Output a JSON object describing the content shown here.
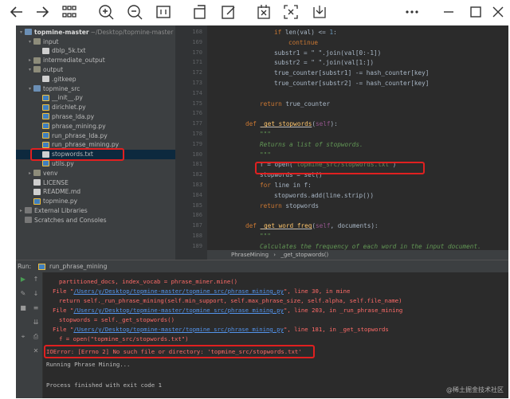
{
  "toolbar": {
    "icons": [
      "back-icon",
      "forward-icon",
      "grid-icon",
      "zoom-in-icon",
      "zoom-out-icon",
      "fit-icon",
      "rotate-icon",
      "edit-icon",
      "grid-select-icon",
      "crop-icon",
      "download-icon",
      "more-icon",
      "minimize-icon",
      "maximize-icon",
      "close-icon"
    ]
  },
  "tree": {
    "root_name": "topmine-master",
    "root_path": "~/Desktop/topmine-master",
    "items": [
      {
        "label": "input",
        "kind": "folder",
        "depth": 1,
        "arrow": "▾"
      },
      {
        "label": "dblp_5k.txt",
        "kind": "txt",
        "depth": 2
      },
      {
        "label": "intermediate_output",
        "kind": "folder",
        "depth": 1,
        "arrow": "▸"
      },
      {
        "label": "output",
        "kind": "folder",
        "depth": 1,
        "arrow": "▾"
      },
      {
        "label": ".gitkeep",
        "kind": "txt",
        "depth": 2
      },
      {
        "label": "topmine_src",
        "kind": "folderb",
        "depth": 1,
        "arrow": "▾"
      },
      {
        "label": "__init__.py",
        "kind": "py",
        "depth": 2
      },
      {
        "label": "dirichlet.py",
        "kind": "py",
        "depth": 2
      },
      {
        "label": "phrase_lda.py",
        "kind": "py",
        "depth": 2
      },
      {
        "label": "phrase_mining.py",
        "kind": "py",
        "depth": 2
      },
      {
        "label": "run_phrase_lda.py",
        "kind": "py",
        "depth": 2
      },
      {
        "label": "run_phrase_mining.py",
        "kind": "py",
        "depth": 2
      },
      {
        "label": "stopwords.txt",
        "kind": "txt",
        "depth": 2
      },
      {
        "label": "utils.py",
        "kind": "py",
        "depth": 2
      },
      {
        "label": "venv",
        "kind": "folder",
        "depth": 1,
        "arrow": "▸"
      },
      {
        "label": "LICENSE",
        "kind": "txt",
        "depth": 1
      },
      {
        "label": "README.md",
        "kind": "txt",
        "depth": 1
      },
      {
        "label": "topmine.py",
        "kind": "py",
        "depth": 1
      },
      {
        "label": "External Libraries",
        "kind": "ext",
        "depth": 0,
        "arrow": "▸"
      },
      {
        "label": "Scratches and Consoles",
        "kind": "ext",
        "depth": 0
      }
    ]
  },
  "editor": {
    "lines": [
      "168",
      "169",
      "170",
      "171",
      "172",
      "173",
      "174",
      "175",
      "176",
      "177",
      "178",
      "179",
      "180",
      "181",
      "182",
      "183",
      "184",
      "185",
      "186",
      "187",
      "188",
      "189"
    ],
    "code": {
      "l168": "if len(val) <= 1:",
      "l169": "continue",
      "l170": "substr1 = \" \".join(val[0:-1])",
      "l171": "substr2 = \" \".join(val[1:])",
      "l172": "true_counter[substr1] -= hash_counter[key]",
      "l173": "true_counter[substr2] -= hash_counter[key]",
      "l175": "return true_counter",
      "l177_kw": "def",
      "l177_fn": "_get_stopwords",
      "l177_rest": "(self):",
      "l178": "\"\"\"",
      "l179": "Returns a list of stopwords.",
      "l180": "\"\"\"",
      "l181_pre": "f = open(",
      "l181_str": "\"topmine_src/stopwords.txt\"",
      "l181_post": ")",
      "l182": "stopwords = set()",
      "l183_kw": "for",
      "l183_rest": " line in f:",
      "l184": "stopwords.add(line.strip())",
      "l185_kw": "return",
      "l185_rest": " stopwords",
      "l187_kw": "def",
      "l187_fn": "_get_word_freq",
      "l187_rest": "(self, documents):",
      "l188": "\"\"\"",
      "l189": "Calculates the frequency of each word in the input document."
    },
    "breadcrumb_class": "PhraseMining",
    "breadcrumb_sep": "›",
    "breadcrumb_method": "_get_stopwords()"
  },
  "run": {
    "label": "Run:",
    "config": "run_phrase_mining",
    "output": {
      "o1": "partitioned_docs, index_vocab = phrase_miner.mine()",
      "o2_pre": "File \"",
      "o2_link": "/Users/y/Desktop/topmine-master/topmine_src/phrase_mining.py",
      "o2_post": "\", line 30, in mine",
      "o3": "return self._run_phrase_mining(self.min_support, self.max_phrase_size, self.alpha, self.file_name)",
      "o4_pre": "File \"",
      "o4_link": "/Users/y/Desktop/topmine-master/topmine_src/phrase_mining.py",
      "o4_post": "\", line 203, in _run_phrase_mining",
      "o5": "stopwords = self._get_stopwords()",
      "o6_pre": "File \"",
      "o6_link": "/Users/y/Desktop/topmine-master/topmine_src/phrase_mining.py",
      "o6_post": "\", line 181, in _get_stopwords",
      "o7": "f = open(\"topmine_src/stopwords.txt\")",
      "o8": "IOError: [Errno 2] No such file or directory: 'topmine_src/stopwords.txt'",
      "o9": "Running Phrase Mining...",
      "o10": "Process finished with exit code 1"
    }
  },
  "watermark": "@稀土掘金技术社区",
  "colors": {
    "highlight": "#e02020",
    "error": "#ff6b68",
    "link": "#5394ec"
  }
}
